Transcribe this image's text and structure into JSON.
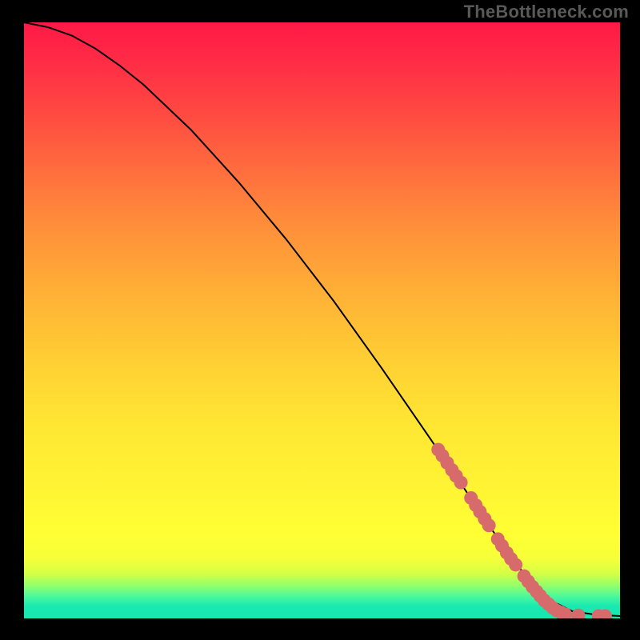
{
  "watermark": "TheBottleneck.com",
  "chart_data": {
    "type": "line",
    "title": "",
    "xlabel": "",
    "ylabel": "",
    "xlim": [
      0,
      100
    ],
    "ylim": [
      0,
      100
    ],
    "grid": false,
    "legend": false,
    "series": [
      {
        "name": "curve",
        "type": "line",
        "x": [
          0,
          4,
          8,
          12,
          16,
          20,
          28,
          36,
          44,
          52,
          60,
          68,
          74,
          78,
          82,
          85,
          88,
          92,
          96,
          100
        ],
        "y": [
          100,
          99.2,
          97.8,
          95.6,
          92.8,
          89.6,
          82.0,
          73.2,
          63.6,
          53.2,
          42.0,
          30.4,
          21.6,
          15.6,
          10.0,
          6.0,
          3.2,
          1.2,
          0.6,
          0.4
        ]
      },
      {
        "name": "markers",
        "type": "scatter",
        "color": "#d76a6a",
        "x": [
          69.5,
          70.2,
          71.0,
          71.8,
          72.5,
          73.3,
          75.0,
          75.8,
          76.5,
          77.3,
          78.0,
          79.5,
          80.2,
          81.0,
          81.7,
          82.5,
          83.9,
          84.6,
          85.3,
          86.0,
          86.6,
          87.3,
          88.0,
          88.7,
          89.4,
          90.1,
          90.8,
          93.0,
          96.4,
          97.5
        ],
        "y": [
          28.3,
          27.3,
          26.1,
          24.9,
          23.9,
          22.8,
          20.2,
          19.0,
          17.9,
          16.7,
          15.6,
          13.3,
          12.2,
          11.0,
          10.0,
          9.0,
          7.1,
          6.2,
          5.3,
          4.5,
          3.8,
          3.0,
          2.4,
          1.8,
          1.3,
          1.0,
          0.7,
          0.5,
          0.4,
          0.4
        ]
      }
    ],
    "background_gradient": {
      "direction": "vertical",
      "stops": [
        {
          "pos": 0.0,
          "color": "#ff1946"
        },
        {
          "pos": 0.46,
          "color": "#ffb236"
        },
        {
          "pos": 0.86,
          "color": "#ffff34"
        },
        {
          "pos": 0.965,
          "color": "#45f7a0"
        },
        {
          "pos": 1.0,
          "color": "#17e8af"
        }
      ]
    }
  }
}
